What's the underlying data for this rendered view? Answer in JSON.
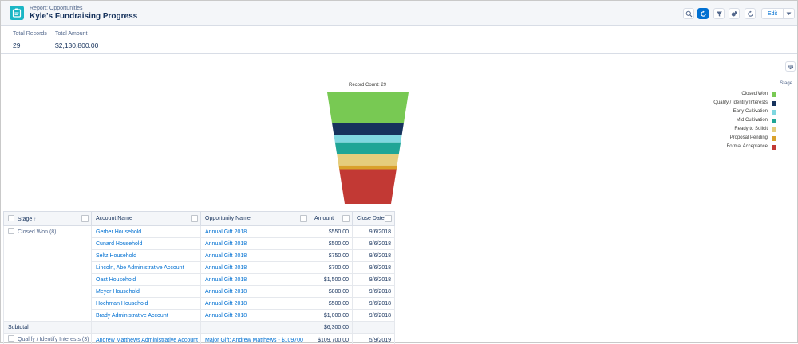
{
  "header": {
    "report_type": "Report: Opportunities",
    "title": "Kyle's Fundraising Progress",
    "edit_label": "Edit",
    "toolbar_icons": [
      "search-icon",
      "refresh-chart-icon",
      "filter-icon",
      "chart-icon",
      "refresh-icon"
    ]
  },
  "summary": {
    "total_records_label": "Total Records",
    "total_records_value": "29",
    "total_amount_label": "Total Amount",
    "total_amount_value": "$2,130,800.00"
  },
  "chart_data": {
    "type": "funnel",
    "title": "Record Count: 29",
    "legend_title": "Stage",
    "legend_placement": "right",
    "stages": [
      {
        "name": "Closed Won",
        "count": 8,
        "color": "#78c953"
      },
      {
        "name": "Qualify / Identify Interests",
        "count": 3,
        "color": "#16325c"
      },
      {
        "name": "Early Cultivation",
        "count": 2,
        "color": "#7fd7e0"
      },
      {
        "name": "Mid Cultivation",
        "count": 3,
        "color": "#1fa596"
      },
      {
        "name": "Ready to Solicit",
        "count": 3,
        "color": "#e5cd7c"
      },
      {
        "name": "Proposal Pending",
        "count": 1,
        "color": "#d9a12b"
      },
      {
        "name": "Formal Acceptance",
        "count": 9,
        "color": "#c23934"
      }
    ]
  },
  "table": {
    "columns": [
      "Stage",
      "Account Name",
      "Opportunity Name",
      "Amount",
      "Close Date"
    ],
    "group_stage": "Closed Won (8)",
    "rows": [
      {
        "account": "Gerber Household",
        "opportunity": "Annual Gift 2018",
        "amount": "$550.00",
        "close_date": "9/6/2018"
      },
      {
        "account": "Cunard Household",
        "opportunity": "Annual Gift 2018",
        "amount": "$500.00",
        "close_date": "9/6/2018"
      },
      {
        "account": "Seltz Household",
        "opportunity": "Annual Gift 2018",
        "amount": "$750.00",
        "close_date": "9/6/2018"
      },
      {
        "account": "Lincoln, Abe Administrative Account",
        "opportunity": "Annual Gift 2018",
        "amount": "$700.00",
        "close_date": "9/6/2018"
      },
      {
        "account": "Oast Household",
        "opportunity": "Annual Gift 2018",
        "amount": "$1,500.00",
        "close_date": "9/6/2018"
      },
      {
        "account": "Meyer Household",
        "opportunity": "Annual Gift 2018",
        "amount": "$800.00",
        "close_date": "9/6/2018"
      },
      {
        "account": "Hochman Household",
        "opportunity": "Annual Gift 2018",
        "amount": "$500.00",
        "close_date": "9/6/2018"
      },
      {
        "account": "Brady Administrative Account",
        "opportunity": "Annual Gift 2018",
        "amount": "$1,000.00",
        "close_date": "9/6/2018"
      }
    ],
    "subtotal_label": "Subtotal",
    "subtotal_amount": "$6,300.00",
    "next_group": {
      "stage": "Qualify / Identify Interests (3)",
      "account": "Andrew Matthews Administrative Account",
      "opportunity": "Major Gift: Andrew Matthews - $109700",
      "amount": "$109,700.00",
      "close_date": "5/9/2019"
    }
  }
}
